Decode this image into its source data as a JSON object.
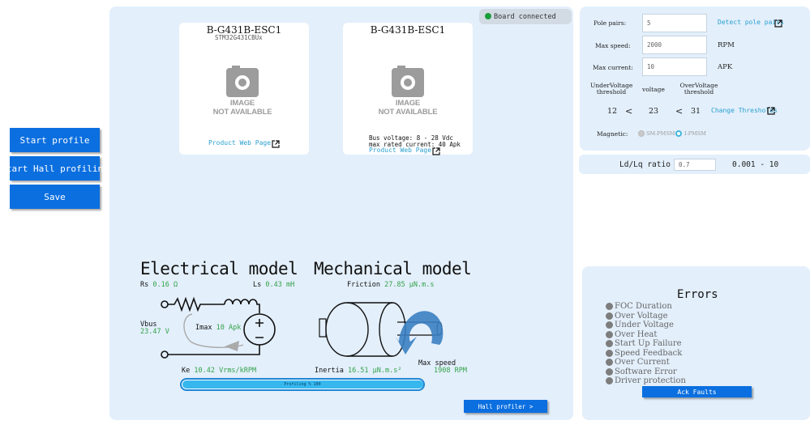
{
  "sidebar": {
    "start_profile": "Start profile",
    "start_hall": "Start Hall profiling",
    "save": "Save"
  },
  "status": {
    "label": "Board connected",
    "color": "#1a9e3a"
  },
  "cards": [
    {
      "title": "B-G431B-ESC1",
      "subtitle": "STM32G431CBUx",
      "image_text_1": "IMAGE",
      "image_text_2": "NOT AVAILABLE",
      "link": "Product Web Page"
    },
    {
      "title": "B-G431B-ESC1",
      "bus_voltage": "Bus voltage: 8 - 28 Vdc",
      "max_current": "max rated current: 40 Apk",
      "image_text_1": "IMAGE",
      "image_text_2": "NOT AVAILABLE",
      "link": "Product Web Page"
    }
  ],
  "electrical": {
    "title": "Electrical model",
    "rs_label": "Rs",
    "rs_value": "0.16 Ω",
    "ls_label": "Ls",
    "ls_value": "0.43 mH",
    "vbus_label": "Vbus",
    "vbus_value": "23.47 V",
    "imax_label": "Imax",
    "imax_value": "10 Apk",
    "ke_label": "Ke",
    "ke_value": "10.42 Vrms/kRPM"
  },
  "mechanical": {
    "title": "Mechanical model",
    "friction_label": "Friction",
    "friction_value": "27.85 μN.m.s",
    "inertia_label": "Inertia",
    "inertia_value": "16.51 μN.m.s²",
    "maxspeed_label": "Max speed",
    "maxspeed_value": "1908 RPM"
  },
  "progress": {
    "label": "Profiling % 100",
    "fraction": 1.0
  },
  "hall_profiler_button": "Hall profiler >",
  "params": {
    "pole_pairs_label": "Pole pairs:",
    "pole_pairs_value": "5",
    "detect_link": "Detect pole pairs",
    "max_speed_label": "Max speed:",
    "max_speed_value": "2000",
    "max_speed_unit": "RPM",
    "max_current_label": "Max current:",
    "max_current_value": "10",
    "max_current_unit": "APK",
    "under_header": "UnderVoltage\nthreshold",
    "voltage_header": "voltage",
    "over_header": "OverVoltage\nthreshold",
    "under_value": "12",
    "voltage_value": "23",
    "over_value": "31",
    "change_link": "Change Thresholds",
    "magnetic_label": "Magnetic:",
    "option_sm": "SM-PMSM",
    "option_i": "I-PMSM"
  },
  "ldlq": {
    "label": "Ld/Lq ratio",
    "value": "0.7",
    "range": "0.001 - 10"
  },
  "errors": {
    "title": "Errors",
    "items": [
      "FOC Duration",
      "Over Voltage",
      "Under Voltage",
      "Over Heat",
      "Start Up Failure",
      "Speed Feedback",
      "Over Current",
      "Software Error",
      "Driver protection"
    ],
    "ack": "Ack Faults"
  },
  "colors": {
    "accent": "#0b6fe0",
    "panel": "#e3effb",
    "value_green": "#33a24a",
    "link": "#2aa0cf"
  }
}
